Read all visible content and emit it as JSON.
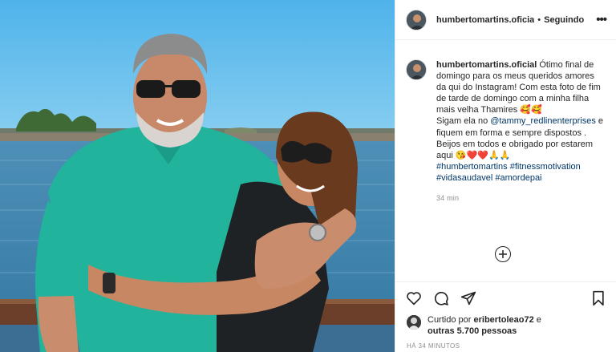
{
  "post": {
    "username": "humbertomartins.oficial",
    "username_truncated": "humbertomartins.oficia",
    "separator": "•",
    "follow_status": "Seguindo",
    "more_label": "•••"
  },
  "caption": {
    "username": "humbertomartins.oficial",
    "text_1": " Ótimo final de domingo para os meus queridos amores da qui do Instagram! Com esta foto de fim de tarde de domingo com a minha filha mais velha Thamires 🥰🥰",
    "text_2": "Sigam ela no ",
    "mention": "@tammy_redlinenterprises",
    "text_3": " e fiquem em forma e sempre dispostos . Beijos em todos e obrigado por estarem aqui 😘❤️❤️🙏🙏",
    "hashtags": [
      "#humbertomartins",
      "#fitnessmotivation",
      "#vidasaudavel",
      "#amordepai"
    ],
    "time": "34 min"
  },
  "likes": {
    "prefix": "Curtido por ",
    "liker": "eribertoleao72",
    "middle": " e ",
    "others": "outras 5.700 pessoas"
  },
  "timestamp": "HÁ 34 MINUTOS",
  "colors": {
    "link": "#00376b",
    "meta": "#8e8e8e",
    "border": "#efefef",
    "text": "#262626"
  },
  "icons": {
    "like": "heart-icon",
    "comment": "comment-icon",
    "share": "share-icon",
    "save": "bookmark-icon",
    "add": "plus-circle-icon",
    "more": "more-icon"
  }
}
